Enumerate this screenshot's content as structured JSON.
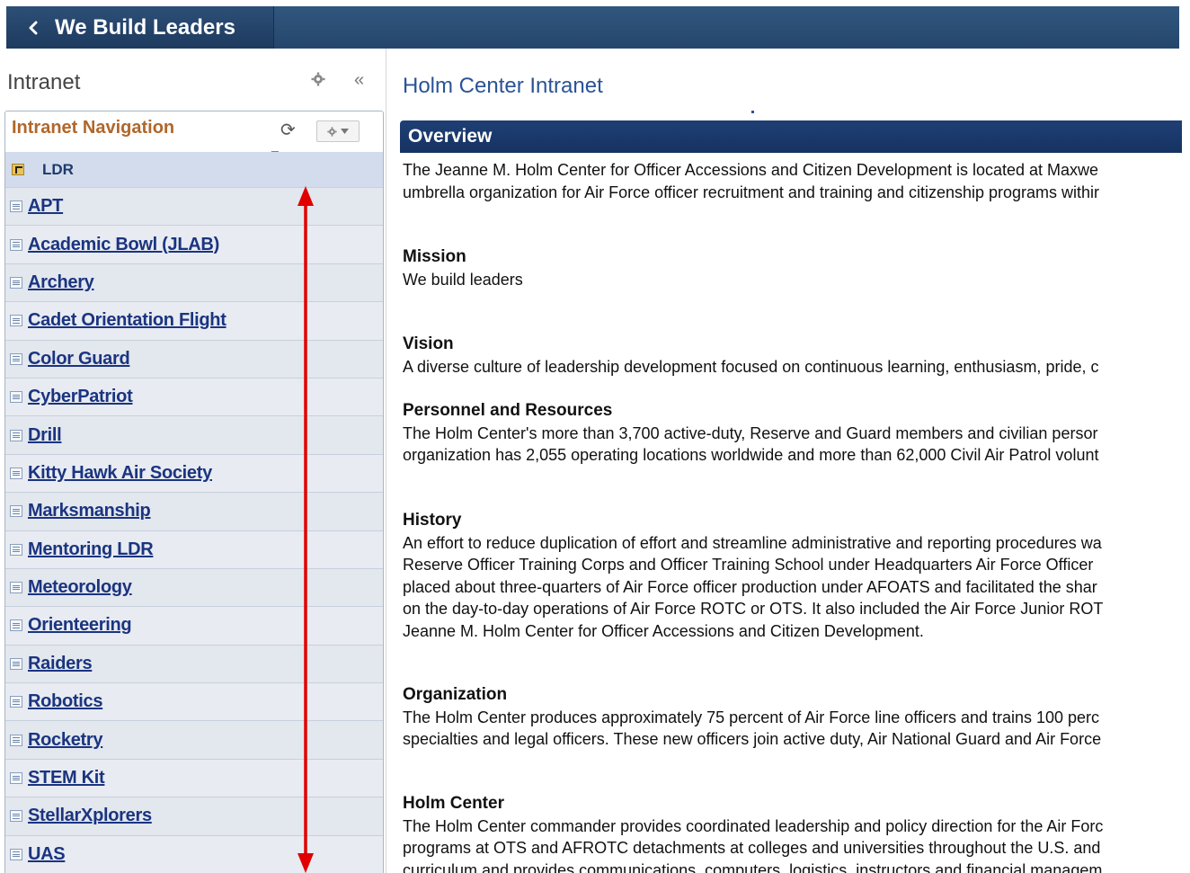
{
  "header": {
    "back_label": "We Build Leaders"
  },
  "left_pane": {
    "title": "Intranet",
    "collapse_glyph": "«",
    "nav": {
      "title": "Intranet Navigation",
      "refresh_glyph": "⟳",
      "parent": "LDR",
      "items": [
        "APT",
        "Academic Bowl (JLAB)",
        "Archery",
        "Cadet Orientation Flight",
        "Color Guard",
        "CyberPatriot",
        "Drill",
        "Kitty Hawk Air Society",
        "Marksmanship",
        "Mentoring LDR",
        "Meteorology",
        "Orienteering",
        "Raiders",
        "Robotics",
        "Rocketry",
        "STEM Kit",
        "StellarXplorers",
        "UAS"
      ]
    }
  },
  "main": {
    "title": "Holm Center Intranet",
    "overview_heading": "Overview",
    "overview_lines": [
      "The Jeanne M. Holm Center for Officer Accessions and Citizen Development is located at Maxwe",
      "umbrella organization for Air Force officer recruitment and training and citizenship programs withir"
    ],
    "mission": {
      "heading": "Mission",
      "lines": [
        "We build leaders"
      ]
    },
    "vision": {
      "heading": "Vision",
      "lines": [
        "A diverse culture of leadership development focused on continuous learning, enthusiasm, pride, c"
      ]
    },
    "personnel": {
      "heading": "Personnel and Resources",
      "lines": [
        "The Holm Center's more than 3,700 active-duty, Reserve and Guard members and civilian persor",
        "organization has 2,055 operating locations worldwide and more than 62,000 Civil Air Patrol volunt"
      ]
    },
    "history": {
      "heading": "History",
      "lines": [
        "An effort to reduce duplication of effort and streamline administrative and reporting procedures wa",
        "Reserve Officer Training Corps and Officer Training School under Headquarters Air Force Officer",
        "placed about three-quarters of Air Force officer production under AFOATS and facilitated the shar",
        "on the day-to-day operations of Air Force ROTC or OTS. It also included the Air Force Junior ROT",
        "Jeanne M. Holm Center for Officer Accessions and Citizen Development."
      ]
    },
    "organization": {
      "heading": "Organization",
      "lines": [
        "The Holm Center produces approximately 75 percent of Air Force line officers and trains 100 perc",
        "specialties and legal officers. These new officers join active duty, Air National Guard and Air Force"
      ]
    },
    "holm_center": {
      "heading": "Holm Center",
      "lines": [
        "The Holm Center commander provides coordinated leadership and policy direction for the Air Forc",
        "programs at OTS and AFROTC detachments at colleges and universities throughout the U.S. and",
        "curriculum and provides communications, computers, logistics, instructors and financial managem"
      ]
    }
  },
  "colors": {
    "header_bg": "#25466c",
    "nav_title": "#b0672a",
    "link": "#1a3480",
    "overview_bar": "#1f3f74",
    "annotation_arrow": "#e00000"
  }
}
